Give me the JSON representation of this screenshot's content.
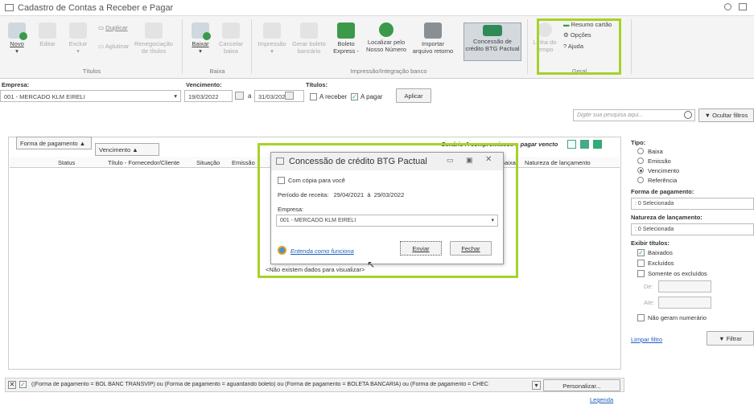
{
  "window": {
    "title": "Cadastro de Contas a Receber e Pagar"
  },
  "ribbon": {
    "novo": "Novo",
    "editar": "Editar",
    "excluir": "Excluir",
    "duplicar": "Duplicar",
    "aglutinar": "Aglutinar",
    "renegociacao_1": "Renegociação",
    "renegociacao_2": "de títulos",
    "group_titulos": "Títulos",
    "baixar": "Baixar",
    "cancelar_1": "Cancelar",
    "cancelar_2": "baixa",
    "group_baixa": "Baixa",
    "impressao": "Impressão",
    "gerar_boleto_1": "Gerar boleto",
    "gerar_boleto_2": "bancário",
    "boleto_1": "Boleto",
    "boleto_2": "Express -",
    "localizar_1": "Localizar pelo",
    "localizar_2": "Nosso Número",
    "importar_1": "Importar",
    "importar_2": "arquivo retorno",
    "concessao_1": "Concessão de",
    "concessao_2": "crédito BTG Pactual",
    "group_impressao": "Impressão/Integração banco",
    "linha_1": "Linha do",
    "linha_2": "tempo",
    "resumo": "Resumo cartão",
    "opcoes": "Opções",
    "ajuda": "Ajuda",
    "group_geral": "Geral"
  },
  "filters": {
    "empresa_label": "Empresa:",
    "empresa_value": "001 - MERCADO KLM EIRELI",
    "vencimento_label": "Vencimento:",
    "venc_from": "19/03/2022",
    "venc_sep": "a",
    "venc_to": "31/03/2022",
    "titulos_label": "Títulos:",
    "a_receber": "A receber",
    "a_pagar": "A pagar",
    "aplicar": "Aplicar",
    "search_placeholder": "Digite sua pesquisa aqui...",
    "ocultar_filtros": "Ocultar filtros"
  },
  "grid": {
    "group_forma": "Forma de pagamento",
    "group_vencimento": "Vencimento",
    "toolbar_text": "Cenário A compromissos a pagar vencto",
    "columns": [
      "Status",
      "Título - Fornecedor/Cliente",
      "Situação",
      "Emissão",
      "Baixa",
      "Natureza de lançamento"
    ],
    "empty": "<Não existem dados para visualizar>"
  },
  "dialog": {
    "title": "Concessão de crédito BTG Pactual",
    "copia": "Com cópia para você",
    "periodo_label": "Período de receita:",
    "periodo_from": "29/04/2021",
    "periodo_sep": "à",
    "periodo_to": "29/03/2022",
    "empresa_label": "Empresa:",
    "empresa_value": "001 - MERCADO KLM EIRELI",
    "link": "Entenda como funciona",
    "enviar": "Enviar",
    "fechar": "Fechar"
  },
  "side": {
    "tipo_label": "Tipo:",
    "tipo_options": [
      "Baixa",
      "Emissão",
      "Vencimento",
      "Referência"
    ],
    "tipo_selected": "Vencimento",
    "forma_label": "Forma de pagamento:",
    "forma_value": ": 0 Selecionada",
    "natureza_label": "Natureza de lançamento:",
    "natureza_value": ": 0 Selecionada",
    "exibir_label": "Exibir títulos:",
    "baixados": "Baixados",
    "excluidos": "Excluídos",
    "somente_excluidos": "Somente os excluídos",
    "de": "De:",
    "ate": "Ate:",
    "nao_geram": "Não geram numerário",
    "limpar": "Limpar filtro",
    "filtrar": "Filtrar"
  },
  "footer": {
    "filter_text": "((Forma de pagamento = BOL BANC TRANSVIP) ou (Forma de pagamento = aguardando boleto) ou (Forma de pagamento = BOLETA BANCARIA) ou (Forma de pagamento = CHEC",
    "personalizar": "Personalizar...",
    "legenda": "Legenda"
  },
  "colors": {
    "highlight": "#a6d22a",
    "link": "#1f5fbf",
    "green_icon": "#3a9a4a"
  }
}
